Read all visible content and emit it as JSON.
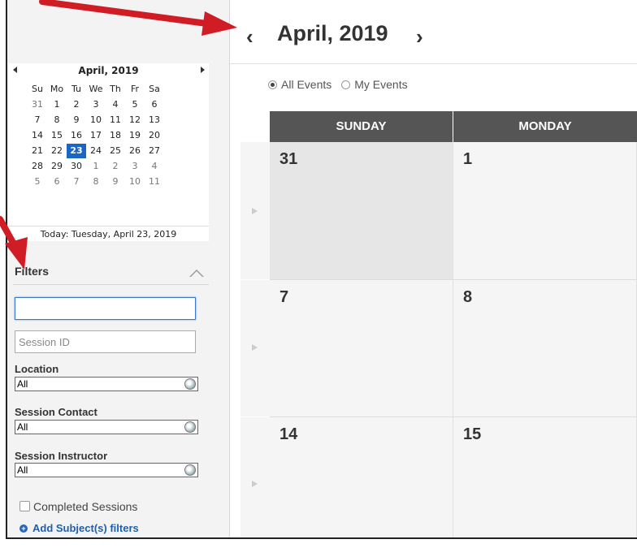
{
  "mini_calendar": {
    "title": "April, 2019",
    "weekdays": [
      "Su",
      "Mo",
      "Tu",
      "We",
      "Th",
      "Fr",
      "Sa"
    ],
    "weeks": [
      [
        "31",
        "1",
        "2",
        "3",
        "4",
        "5",
        "6"
      ],
      [
        "7",
        "8",
        "9",
        "10",
        "11",
        "12",
        "13"
      ],
      [
        "14",
        "15",
        "16",
        "17",
        "18",
        "19",
        "20"
      ],
      [
        "21",
        "22",
        "23",
        "24",
        "25",
        "26",
        "27"
      ],
      [
        "28",
        "29",
        "30",
        "1",
        "2",
        "3",
        "4"
      ],
      [
        "5",
        "6",
        "7",
        "8",
        "9",
        "10",
        "11"
      ]
    ],
    "selected": "23",
    "today_text": "Today: Tuesday, April 23, 2019"
  },
  "filters": {
    "title": "Filters",
    "search_value": "",
    "session_id_placeholder": "Session ID",
    "location": {
      "label": "Location",
      "value": "All"
    },
    "session_contact": {
      "label": "Session Contact",
      "value": "All"
    },
    "session_instructor": {
      "label": "Session Instructor",
      "value": "All"
    },
    "completed_label": "Completed Sessions",
    "add_subject_label": "Add Subject(s) filters"
  },
  "main": {
    "prev_symbol": "‹",
    "next_symbol": "›",
    "month_title": "April, 2019",
    "radio_all": "All Events",
    "radio_mine": "My Events",
    "days": [
      "SUNDAY",
      "MONDAY"
    ],
    "weeks": [
      [
        "31",
        "1"
      ],
      [
        "7",
        "8"
      ],
      [
        "14",
        "15"
      ]
    ]
  },
  "colors": {
    "accent": "#1a66c2",
    "header_bar": "#555555",
    "annotation": "#d01c24"
  }
}
